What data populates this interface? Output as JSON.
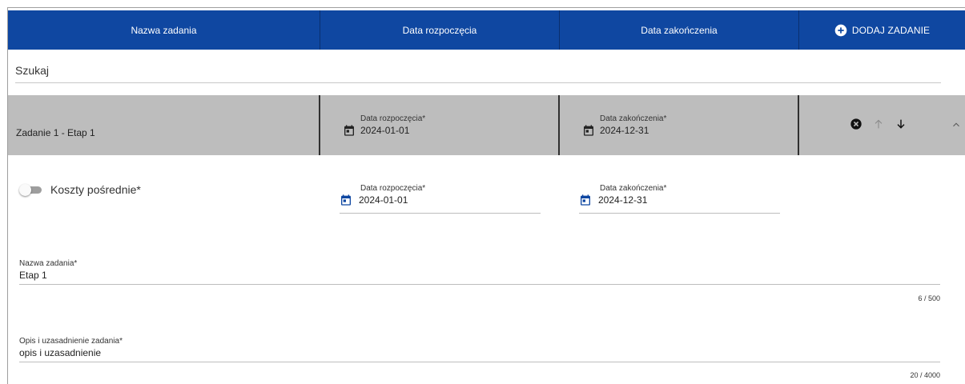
{
  "header": {
    "col_name": "Nazwa zadania",
    "col_start": "Data rozpoczęcia",
    "col_end": "Data zakończenia",
    "add_button": "DODAJ ZADANIE"
  },
  "search": {
    "placeholder": "Szukaj"
  },
  "task": {
    "title": "Zadanie 1 - Etap 1",
    "start_label": "Data rozpoczęcia*",
    "start_value": "2024-01-01",
    "end_label": "Data zakończenia*",
    "end_value": "2024-12-31"
  },
  "details": {
    "indirect_costs_label": "Koszty pośrednie*",
    "indirect_costs_enabled": false,
    "start_label": "Data rozpoczęcia*",
    "start_value": "2024-01-01",
    "end_label": "Data zakończenia*",
    "end_value": "2024-12-31",
    "name_label": "Nazwa zadania*",
    "name_value": "Etap 1",
    "name_counter": "6 / 500",
    "desc_label": "Opis i uzasadnienie zadania*",
    "desc_value": "opis i uzasadnienie",
    "desc_counter": "20 / 4000"
  },
  "icons": {
    "add": "add-circle-icon",
    "remove": "cancel-circle-icon",
    "move_up": "arrow-up-icon",
    "move_down": "arrow-down-icon",
    "collapse": "chevron-up-icon",
    "calendar": "calendar-icon"
  },
  "colors": {
    "header_bg": "#0f47a1",
    "row_bg": "#bdbdbd",
    "calendar_accent": "#0f47a1"
  }
}
